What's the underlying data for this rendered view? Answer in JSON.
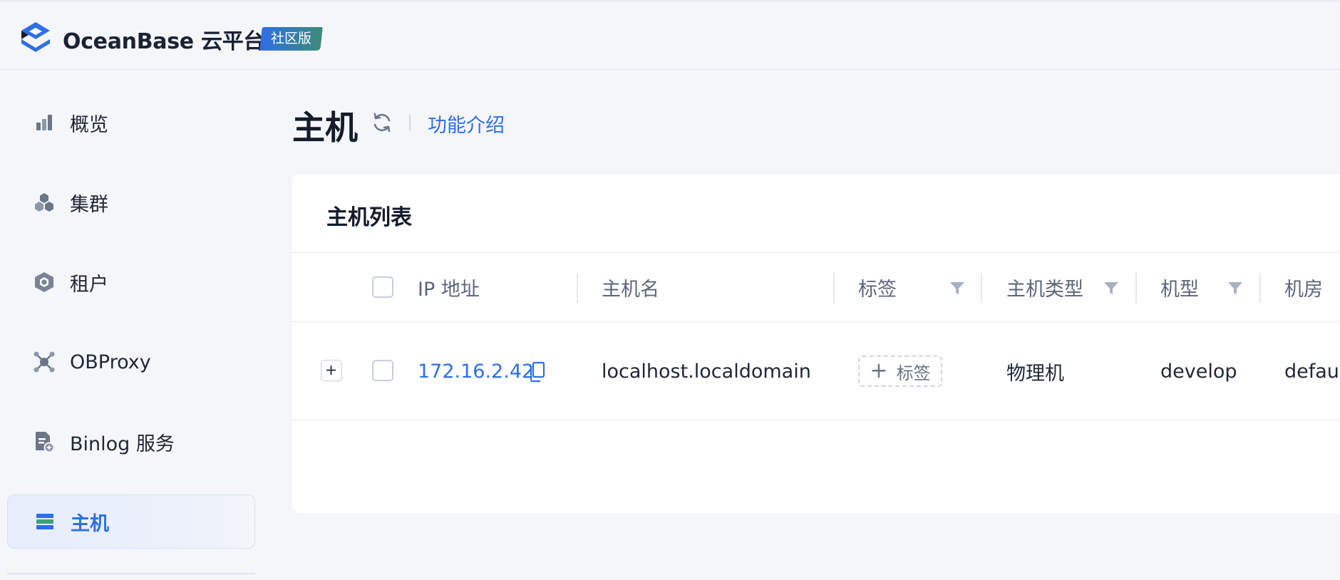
{
  "header": {
    "brand": "OceanBase 云平台",
    "edition": "社区版"
  },
  "sidebar": {
    "items": [
      {
        "label": "概览",
        "icon": "bar-chart-icon"
      },
      {
        "label": "集群",
        "icon": "cluster-icon"
      },
      {
        "label": "租户",
        "icon": "tenant-icon"
      },
      {
        "label": "OBProxy",
        "icon": "proxy-icon"
      },
      {
        "label": "Binlog 服务",
        "icon": "binlog-icon"
      },
      {
        "label": "主机",
        "icon": "host-icon",
        "active": true
      }
    ]
  },
  "page": {
    "title": "主机",
    "intro_link": "功能介绍"
  },
  "card": {
    "title": "主机列表",
    "columns": [
      "IP 地址",
      "主机名",
      "标签",
      "主机类型",
      "机型",
      "机房"
    ],
    "rows": [
      {
        "ip": "172.16.2.42",
        "hostname": "localhost.localdomain",
        "tag_button": "标签",
        "host_type": "物理机",
        "model": "develop",
        "idc": "default"
      }
    ]
  },
  "colors": {
    "accent": "#2f6fe5",
    "background": "#f4f6fa",
    "text": "#1f2735"
  }
}
